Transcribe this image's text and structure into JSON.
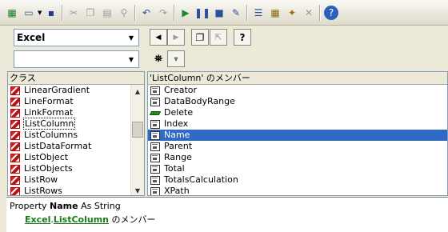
{
  "toolbar": {
    "buttons": [
      {
        "name": "excel-view-icon",
        "glyph": "▦",
        "color": "#1d7b2c"
      },
      {
        "name": "userform-icon",
        "glyph": "▭",
        "color": "#2d5aa0"
      },
      {
        "name": "save-icon",
        "glyph": "▪",
        "color": "#1e3c8c"
      },
      {
        "name": "cut-icon",
        "glyph": "✂",
        "color": "#9a9a9a"
      },
      {
        "name": "copy-icon",
        "glyph": "❐",
        "color": "#9a9a9a"
      },
      {
        "name": "paste-icon",
        "glyph": "▤",
        "color": "#9a9a9a"
      },
      {
        "name": "find-icon",
        "glyph": "⚲",
        "color": "#9a9a9a"
      },
      {
        "name": "undo-icon",
        "glyph": "↶",
        "color": "#2c4f9c"
      },
      {
        "name": "redo-icon",
        "glyph": "↷",
        "color": "#9a9a9a"
      },
      {
        "name": "run-icon",
        "glyph": "▶",
        "color": "#1f8a2d"
      },
      {
        "name": "pause-icon",
        "glyph": "❚❚",
        "color": "#2c4f9c"
      },
      {
        "name": "stop-icon",
        "glyph": "■",
        "color": "#2c4f9c"
      },
      {
        "name": "design-mode-icon",
        "glyph": "✎",
        "color": "#2c4f9c"
      },
      {
        "name": "project-explorer-icon",
        "glyph": "☰",
        "color": "#2c4f9c"
      },
      {
        "name": "properties-window-icon",
        "glyph": "▦",
        "color": "#8a6a10"
      },
      {
        "name": "object-browser-icon",
        "glyph": "✦",
        "color": "#a06a00"
      },
      {
        "name": "toolbox-icon",
        "glyph": "✕",
        "color": "#9a9a9a"
      },
      {
        "name": "help-icon",
        "glyph": "?",
        "color": "#ffffff"
      }
    ]
  },
  "library_combo": {
    "value": "Excel"
  },
  "search_combo": {
    "value": ""
  },
  "class_pane": {
    "header": "クラス",
    "items": [
      "LinearGradient",
      "LineFormat",
      "LinkFormat",
      "ListColumn",
      "ListColumns",
      "ListDataFormat",
      "ListObject",
      "ListObjects",
      "ListRow",
      "ListRows"
    ],
    "focused_index": 3
  },
  "members_pane": {
    "header": "'ListColumn' のメンバー",
    "items": [
      {
        "label": "Creator",
        "kind": "property"
      },
      {
        "label": "DataBodyRange",
        "kind": "property"
      },
      {
        "label": "Delete",
        "kind": "method"
      },
      {
        "label": "Index",
        "kind": "property"
      },
      {
        "label": "Name",
        "kind": "property"
      },
      {
        "label": "Parent",
        "kind": "property"
      },
      {
        "label": "Range",
        "kind": "property"
      },
      {
        "label": "Total",
        "kind": "property"
      },
      {
        "label": "TotalsCalculation",
        "kind": "property"
      },
      {
        "label": "XPath",
        "kind": "property"
      }
    ],
    "selected_index": 4
  },
  "details": {
    "prefix": "Property",
    "member": "Name",
    "suffix": "As String",
    "library_link": "Excel",
    "dot": ".",
    "class_link": "ListColumn",
    "member_of": "のメンバー"
  },
  "colors": {
    "selection": "#316ac5",
    "link": "#1a7a1a"
  }
}
